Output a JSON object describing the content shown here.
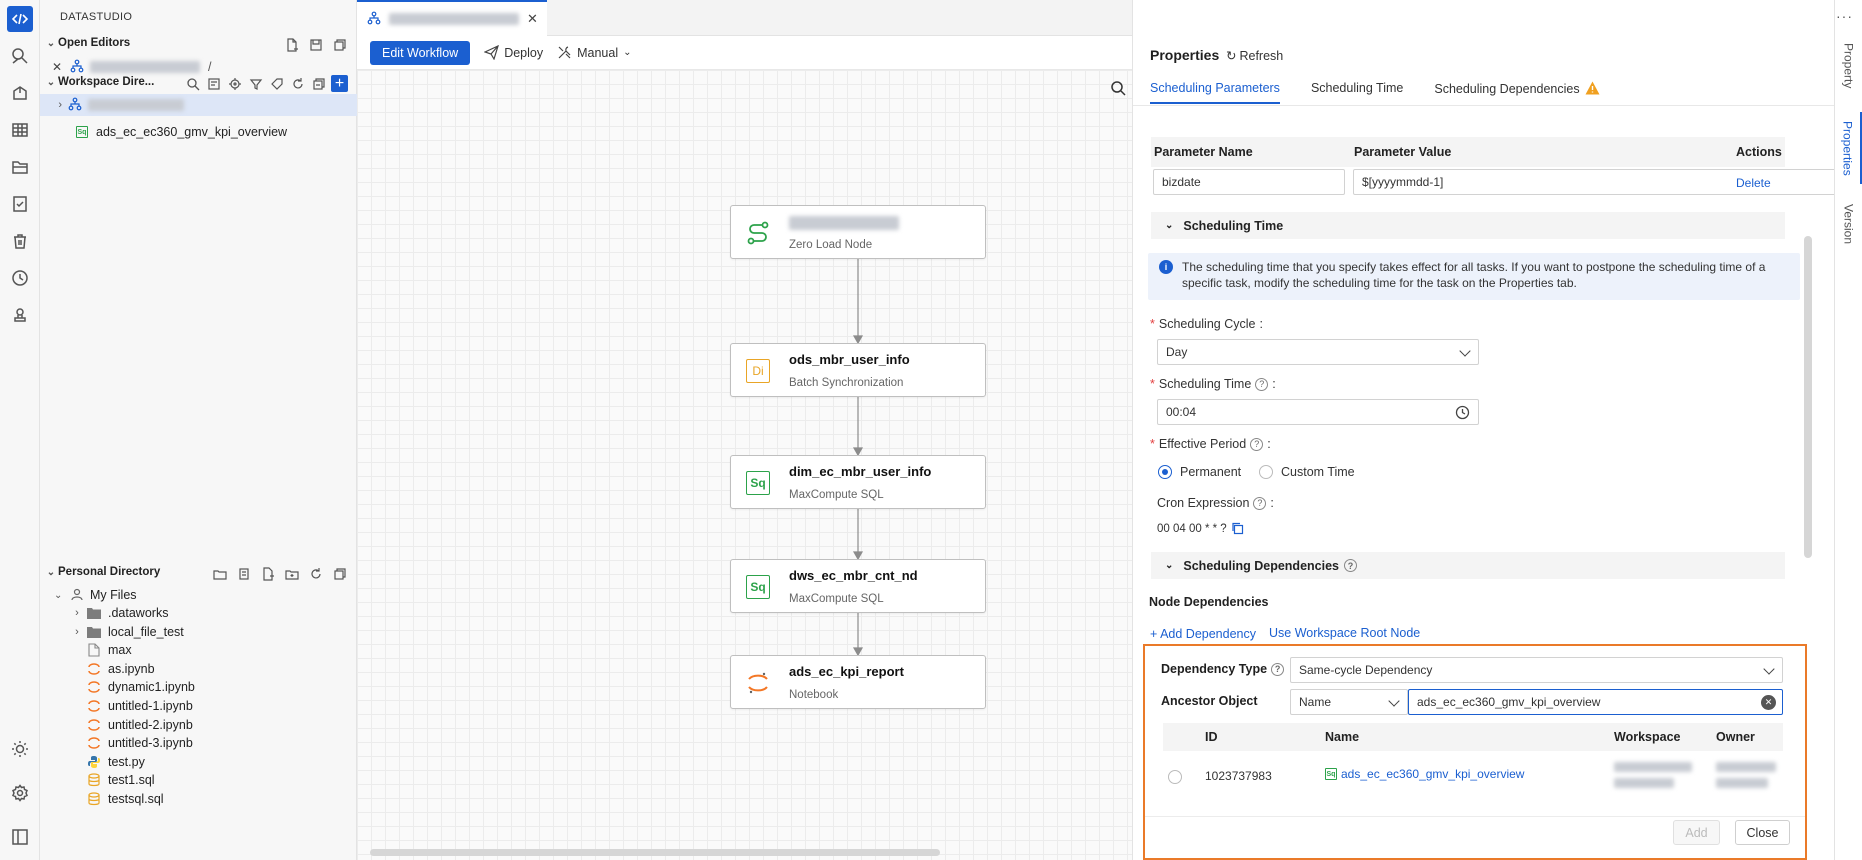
{
  "app": {
    "title": "DATASTUDIO"
  },
  "explorer": {
    "open_editors": {
      "label": "Open Editors",
      "path_sep": "/"
    },
    "workspace": {
      "label": "Workspace Dire...",
      "file": "ads_ec_ec360_gmv_kpi_overview"
    },
    "personal": {
      "label": "Personal Directory",
      "root": "My Files",
      "items": [
        {
          "name": ".dataworks",
          "kind": "folder"
        },
        {
          "name": "local_file_test",
          "kind": "folder"
        },
        {
          "name": "max",
          "kind": "file"
        },
        {
          "name": "as.ipynb",
          "kind": "notebook"
        },
        {
          "name": "dynamic1.ipynb",
          "kind": "notebook"
        },
        {
          "name": "untitled-1.ipynb",
          "kind": "notebook"
        },
        {
          "name": "untitled-2.ipynb",
          "kind": "notebook"
        },
        {
          "name": "untitled-3.ipynb",
          "kind": "notebook"
        },
        {
          "name": "test.py",
          "kind": "python"
        },
        {
          "name": "test1.sql",
          "kind": "sql"
        },
        {
          "name": "testsql.sql",
          "kind": "sql"
        }
      ]
    }
  },
  "toolbar": {
    "edit_workflow": "Edit Workflow",
    "deploy": "Deploy",
    "manual": "Manual"
  },
  "nodes": [
    {
      "title": "",
      "type": "Zero Load Node",
      "icon": "zero-load-icon"
    },
    {
      "title": "ods_mbr_user_info",
      "type": "Batch Synchronization",
      "icon": "di-icon",
      "badge": "Di"
    },
    {
      "title": "dim_ec_mbr_user_info",
      "type": "MaxCompute SQL",
      "icon": "sql-icon",
      "badge": "Sq"
    },
    {
      "title": "dws_ec_mbr_cnt_nd",
      "type": "MaxCompute SQL",
      "icon": "sql-icon",
      "badge": "Sq"
    },
    {
      "title": "ads_ec_kpi_report",
      "type": "Notebook",
      "icon": "notebook-icon"
    }
  ],
  "properties": {
    "title": "Properties",
    "refresh": "Refresh",
    "tabs": [
      "Scheduling Parameters",
      "Scheduling Time",
      "Scheduling Dependencies"
    ],
    "params_table": {
      "headers": [
        "Parameter Name",
        "Parameter Value",
        "Actions"
      ],
      "row": {
        "name": "bizdate",
        "value": "$[yyyymmdd-1]",
        "action": "Delete"
      }
    },
    "scheduling_time": {
      "header": "Scheduling Time",
      "info": "The scheduling time that you specify takes effect for all tasks. If you want to postpone the scheduling time of a specific task, modify the scheduling time for the task on the Properties tab.",
      "cycle_label": "Scheduling Cycle",
      "cycle_value": "Day",
      "time_label": "Scheduling Time",
      "time_value": "00:04",
      "period_label": "Effective Period",
      "period_options": [
        "Permanent",
        "Custom Time"
      ],
      "cron_label": "Cron Expression",
      "cron_value": "00 04 00 * * ?"
    },
    "dependencies": {
      "header": "Scheduling Dependencies",
      "node_deps": "Node Dependencies",
      "add_dep": "+ Add Dependency",
      "use_root": "Use Workspace Root Node",
      "dep_type_label": "Dependency Type",
      "dep_type_value": "Same-cycle Dependency",
      "ancestor_label": "Ancestor Object",
      "ancestor_field": "Name",
      "ancestor_search": "ads_ec_ec360_gmv_kpi_overview",
      "result_headers": [
        "ID",
        "Name",
        "Workspace",
        "Owner"
      ],
      "result_row": {
        "id": "1023737983",
        "name": "ads_ec_ec360_gmv_kpi_overview"
      },
      "add_btn": "Add",
      "close_btn": "Close"
    }
  },
  "rail": [
    "Property",
    "Properties",
    "Version"
  ],
  "colors": {
    "accent": "#1b5fd0",
    "highlight": "#ea7a29",
    "warning": "#f0a020"
  }
}
